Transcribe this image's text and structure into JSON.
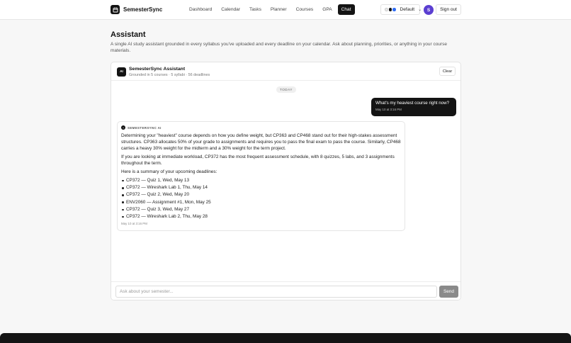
{
  "header": {
    "brand": "SemesterSync",
    "nav": [
      {
        "label": "Dashboard",
        "active": false
      },
      {
        "label": "Calendar",
        "active": false
      },
      {
        "label": "Tasks",
        "active": false
      },
      {
        "label": "Planner",
        "active": false
      },
      {
        "label": "Courses",
        "active": false
      },
      {
        "label": "GPA",
        "active": false
      },
      {
        "label": "Chat",
        "active": true
      }
    ],
    "theme": {
      "label": "Default",
      "swatch_colors": [
        "#e8e8e8",
        "#141414",
        "#2f6df6"
      ]
    },
    "avatar_initial": "S",
    "signout_label": "Sign out"
  },
  "page": {
    "title": "Assistant",
    "description": "A single AI study assistant grounded in every syllabus you've uploaded and every deadline on your calendar. Ask about planning, priorities, or anything in your course materials."
  },
  "chat": {
    "assistant_name": "SemesterSync Assistant",
    "assistant_sub": "Grounded in 5 courses · 5 syllabi · 56 deadlines",
    "badge": "AI",
    "clear_label": "Clear",
    "day_divider": "TODAY",
    "user_message": {
      "text": "What's my heaviest course right now?",
      "time": "May 10 at 3:16 PM"
    },
    "ai_message": {
      "label": "SEMESTERSYNC AI",
      "paragraphs": [
        "Determining your \"heaviest\" course depends on how you define weight, but CP363 and CP468 stand out for their high-stakes assessment structures. CP363 allocates 50% of your grade to assignments and requires you to pass the final exam to pass the course. Similarly, CP468 carries a heavy 30% weight for the midterm and a 30% weight for the term project.",
        "If you are looking at immediate workload, CP372 has the most frequent assessment schedule, with 8 quizzes, 5 labs, and 3 assignments throughout the term.",
        "Here is a summary of your upcoming deadlines:"
      ],
      "deadlines": [
        "CP372 — Quiz 1, Wed, May 13",
        "CP372 — Wireshark Lab 1, Thu, May 14",
        "CP372 — Quiz 2, Wed, May 20",
        "ENV2060 — Assignment #1, Mon, May 25",
        "CP372 — Quiz 3, Wed, May 27",
        "CP372 — Wireshark Lab 2, Thu, May 28"
      ],
      "time": "May 10 at 3:16 PM"
    },
    "input_placeholder": "Ask about your semester...",
    "input_value": "",
    "send_label": "Send"
  }
}
